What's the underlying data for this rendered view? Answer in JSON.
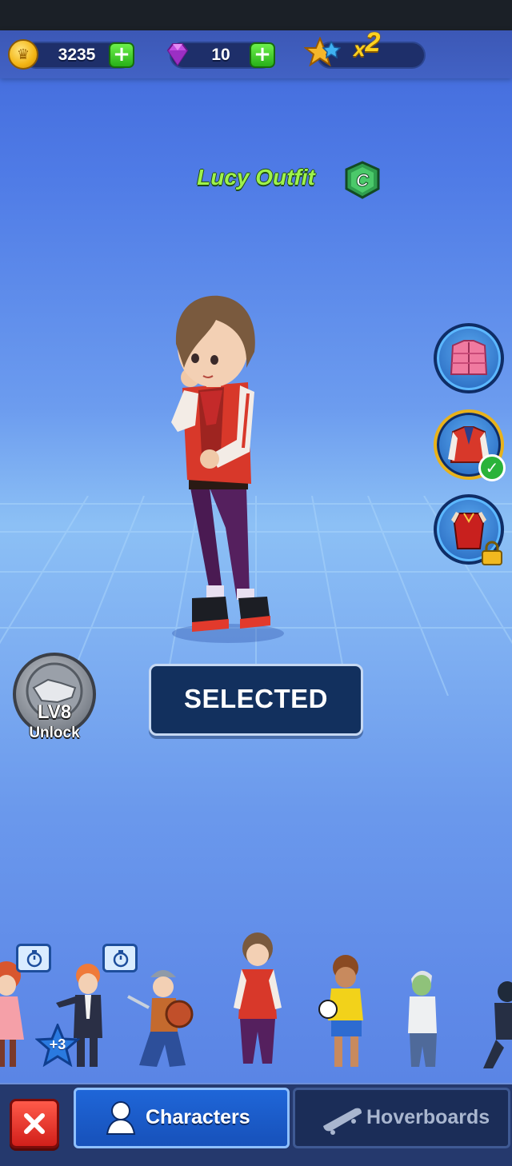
{
  "hud": {
    "coins": "3235",
    "gems": "10",
    "multiplier_prefix": "x",
    "multiplier_value": "2",
    "icons": {
      "coin": "coin-icon",
      "gem": "gem-icon",
      "score": "star-multiplier-icon",
      "add": "plus-icon"
    }
  },
  "outfit": {
    "title": "Lucy Outfit",
    "grade": "C"
  },
  "outfit_options": [
    {
      "name": "pink-puffer-jacket",
      "state": "available"
    },
    {
      "name": "red-varsity-jacket",
      "state": "equipped"
    },
    {
      "name": "red-qipao-dress",
      "state": "locked"
    }
  ],
  "unlock": {
    "level": "LV8",
    "label": "Unlock"
  },
  "action": {
    "selected_label": "SELECTED"
  },
  "roster": {
    "bonus_label": "+3",
    "characters": [
      "red-dress-girl",
      "tuxedo-boy",
      "viking-boy",
      "lucy",
      "soccer-boy",
      "zombie",
      "ninja"
    ]
  },
  "nav": {
    "characters_label": "Characters",
    "hoverboards_label": "Hoverboards",
    "active_tab": "Characters"
  },
  "colors": {
    "title_green": "#9ef24c",
    "accent_gold": "#ffd21f",
    "panel_navy": "#12305e",
    "close_red": "#e2342a",
    "tab_active_blue": "#1f66d8"
  }
}
